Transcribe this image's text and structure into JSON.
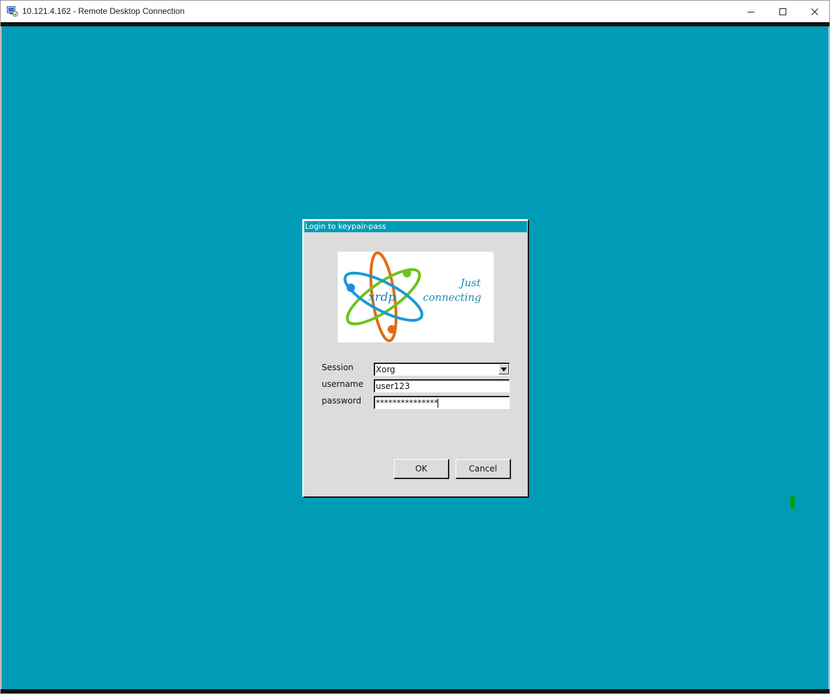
{
  "window": {
    "title": "10.121.4.162 - Remote Desktop Connection",
    "icon": "remote-desktop-icon"
  },
  "colors": {
    "desktop": "#009cb7",
    "dialog_bg": "#dcdcdc",
    "dialog_title_bg": "#009cb7",
    "indicator": "#00a000"
  },
  "dialog": {
    "title": "Login to keypair-pass",
    "logo": {
      "word": "xrdp",
      "tagline_line1": "Just",
      "tagline_line2": "connecting"
    },
    "fields": {
      "session_label": "Session",
      "session_value": "Xorg",
      "username_label": "username",
      "username_value": "user123",
      "password_label": "password",
      "password_value": "***************"
    },
    "buttons": {
      "ok": "OK",
      "cancel": "Cancel"
    }
  }
}
